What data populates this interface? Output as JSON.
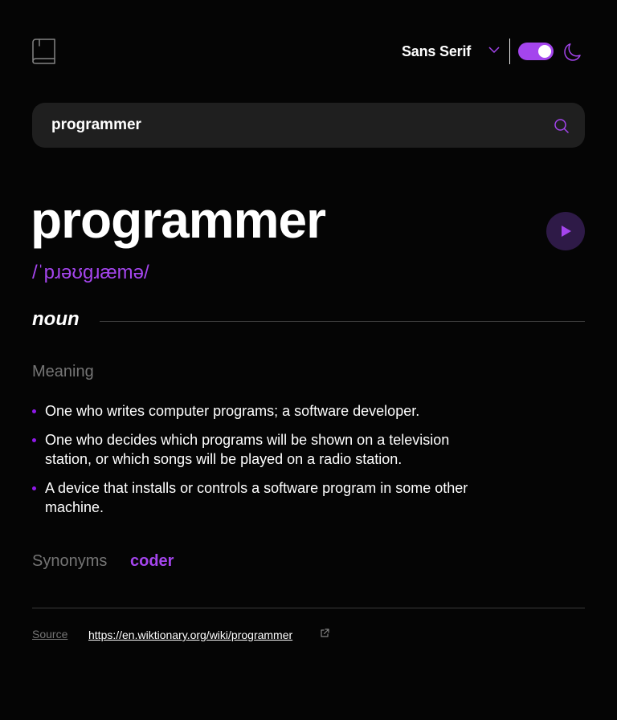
{
  "header": {
    "logo_icon": "book-icon",
    "font_selector": {
      "selected": "Sans Serif",
      "icon": "chevron-down-icon"
    },
    "theme_toggle": {
      "state": "on",
      "icon": "moon-icon"
    }
  },
  "search": {
    "value": "programmer",
    "icon": "search-icon"
  },
  "entry": {
    "word": "programmer",
    "phonetic": "/ˈpɹəʊɡɹæmə/",
    "play_icon": "play-icon",
    "part_of_speech": "noun",
    "meaning_label": "Meaning",
    "definitions": [
      "One who writes computer programs; a software developer.",
      "One who decides which programs will be shown on a television station, or which songs will be played on a radio station.",
      "A device that installs or controls a software program in some other machine."
    ],
    "synonyms_label": "Synonyms",
    "synonyms": [
      "coder"
    ]
  },
  "footer": {
    "source_label": "Source",
    "source_url": "https://en.wiktionary.org/wiki/programmer",
    "external_icon": "external-link-icon"
  },
  "colors": {
    "accent": "#A445ED",
    "background": "#050505",
    "search_bg": "#1F1F1F",
    "muted_text": "#757575"
  }
}
